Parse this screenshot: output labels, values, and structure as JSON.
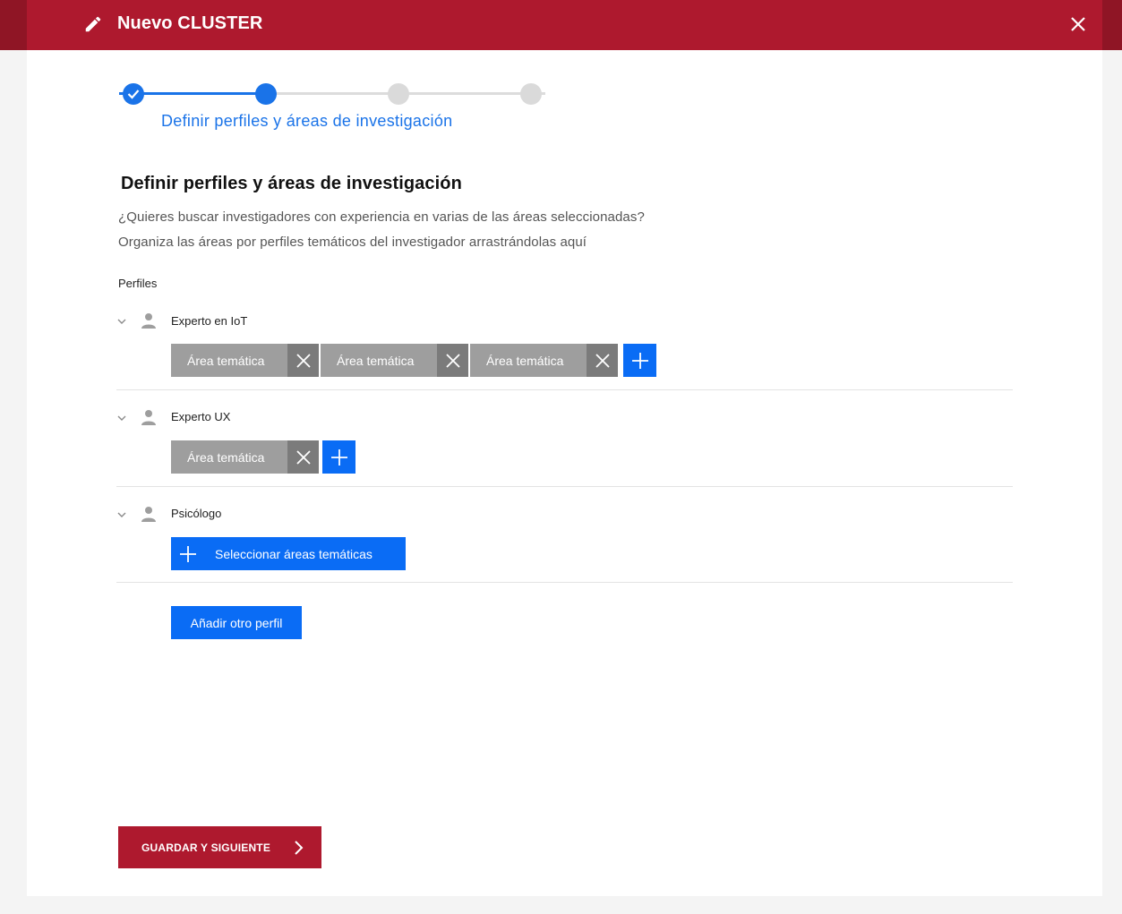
{
  "header": {
    "title": "Nuevo CLUSTER",
    "edit_icon": "pencil-icon",
    "close_icon": "close-icon",
    "color": "#ae192e"
  },
  "stepper": {
    "steps": 4,
    "current_step": 2,
    "current_label": "Definir perfiles y áreas de investigación",
    "accent": "#1a73e8"
  },
  "section": {
    "title": "Definir perfiles y áreas de investigación",
    "description_line1": "¿Quieres buscar investigadores con experiencia en varias de las áreas seleccionadas?",
    "description_line2": "Organiza las áreas por perfiles temáticos del investigador arrastrándolas aquí",
    "profiles_label": "Perfiles"
  },
  "profiles": [
    {
      "name": "Experto en IoT",
      "areas": [
        "Área temática",
        "Área temática",
        "Área temática"
      ]
    },
    {
      "name": "Experto UX",
      "areas": [
        "Área temática"
      ]
    },
    {
      "name": "Psicólogo",
      "areas": [],
      "select_label": "Seleccionar áreas temáticas"
    }
  ],
  "actions": {
    "add_profile": "Añadir otro perfil",
    "save_next": "GUARDAR Y SIGUIENTE"
  },
  "colors": {
    "primary_blue": "#0a6cf5",
    "chip_gray": "#9e9e9e",
    "chip_x_gray": "#7b7b7b",
    "brand_red": "#ae192e"
  }
}
